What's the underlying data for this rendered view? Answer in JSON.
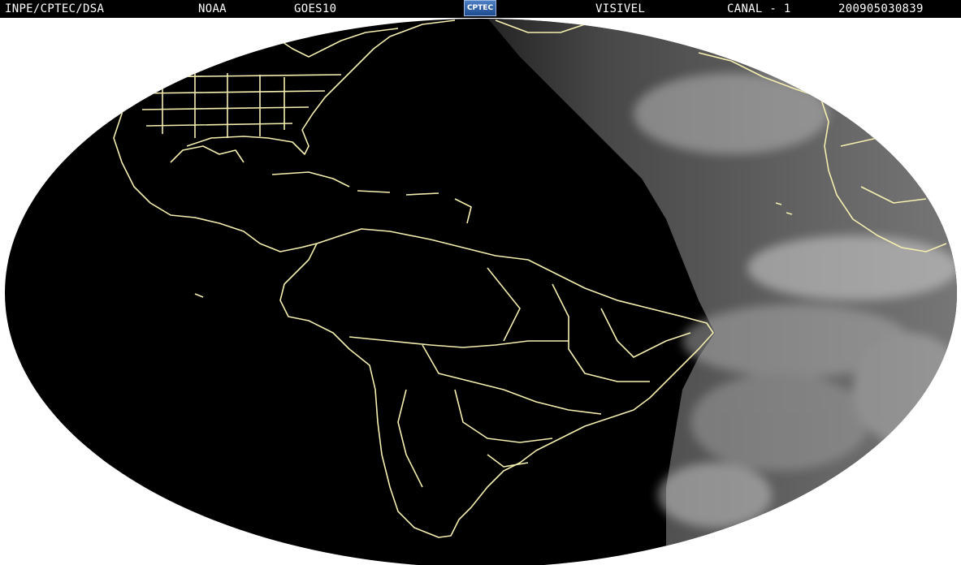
{
  "header": {
    "source": "INPE/CPTEC/DSA",
    "agency": "NOAA",
    "satellite": "GOES10",
    "band": "VISIVEL",
    "channel": "CANAL - 1",
    "timestamp": "200905030839",
    "logo_text": "CPTEC"
  },
  "image": {
    "coastline_color": "#f5efb0",
    "night_color": "#000000",
    "day_cloud_color": "#8a8a8a"
  }
}
